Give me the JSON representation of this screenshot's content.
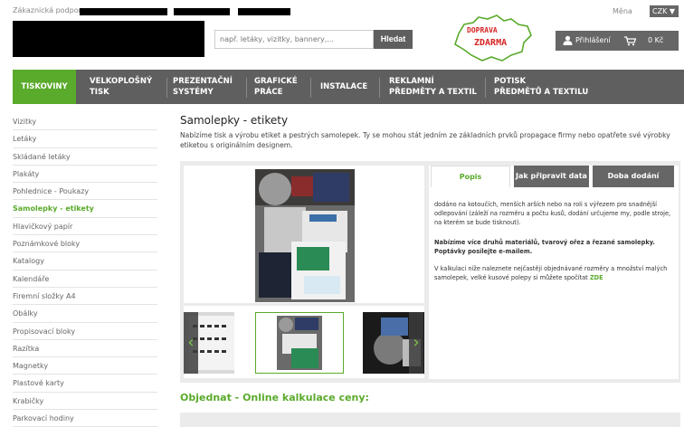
{
  "header": {
    "support_label": "Zákaznická podpora",
    "currency_label": "Měna",
    "currency_value": "CZK ▼",
    "search_placeholder": "např. letáky, vizitky, bannery,...",
    "search_button": "Hledat",
    "delivery_line1": "DOPRAVA",
    "delivery_line2": "ZDARMA",
    "login_label": "Přihlášení",
    "cart_price": "0 Kč",
    "icons": [
      "user-icon",
      "cart-icon"
    ]
  },
  "nav": {
    "items": [
      {
        "line1": "TISKOVINY",
        "line2": ""
      },
      {
        "line1": "VELKOPLOŠNÝ",
        "line2": "TISK"
      },
      {
        "line1": "PREZENTAČNÍ",
        "line2": "SYSTÉMY"
      },
      {
        "line1": "GRAFICKÉ",
        "line2": "PRÁCE"
      },
      {
        "line1": "INSTALACE",
        "line2": ""
      },
      {
        "line1": "REKLAMNÍ",
        "line2": "PŘEDMĚTY A TEXTIL"
      },
      {
        "line1": "POTISK",
        "line2": "PŘEDMĚTŮ A TEXTILU"
      }
    ],
    "active_color": "#5aaa2b"
  },
  "sidebar": {
    "items": [
      "Vizitky",
      "Letáky",
      "Skládané letáky",
      "Plakáty",
      "Pohlednice - Poukazy",
      "Samolepky - etikety",
      "Hlavičkový papír",
      "Poznámkové bloky",
      "Katalogy",
      "Kalendáře",
      "Firemní složky A4",
      "Obálky",
      "Propisovací bloky",
      "Razítka",
      "Magnetky",
      "Plastové karty",
      "Krabičky",
      "Parkovací hodiny"
    ],
    "active_index": 5
  },
  "main": {
    "title": "Samolepky - etikety",
    "description": "Nabízíme tisk a výrobu etiket a pestrých samolepek. Ty se mohou stát jedním ze základních prvků propagace firmy nebo opatřete své výrobky etiketou s originálním designem."
  },
  "tabs": [
    "Popis",
    "Jak připravit data",
    "Doba dodání"
  ],
  "info": {
    "paragraph1": "dodáno na kotoučích, menších arších nebo na roli s výřezem pro snadnější odlepování (záleží na rozměru a počtu kusů, dodání určujeme my, podle stroje, na kterém se bude tisknout).",
    "paragraph2": "Nabízíme více druhů materiálů, tvarový ořez a řezané samolepky. Poptávky posílejte e-mailem.",
    "paragraph3": "V kalkulaci níže naleznete nejčastěji objednávané rozměry a množství malých samolepek, velké kusové polepy si můžete spočítat",
    "link": "ZDE"
  },
  "gallery": {
    "prev": "‹",
    "next": "›"
  },
  "order": {
    "title": "Objednat - Online kalkulace ceny:"
  },
  "colors": {
    "accent": "#5aaa2b",
    "nav_bg": "#5f5f5f",
    "button_dark": "#666666",
    "delivery_red": "#d62323"
  }
}
